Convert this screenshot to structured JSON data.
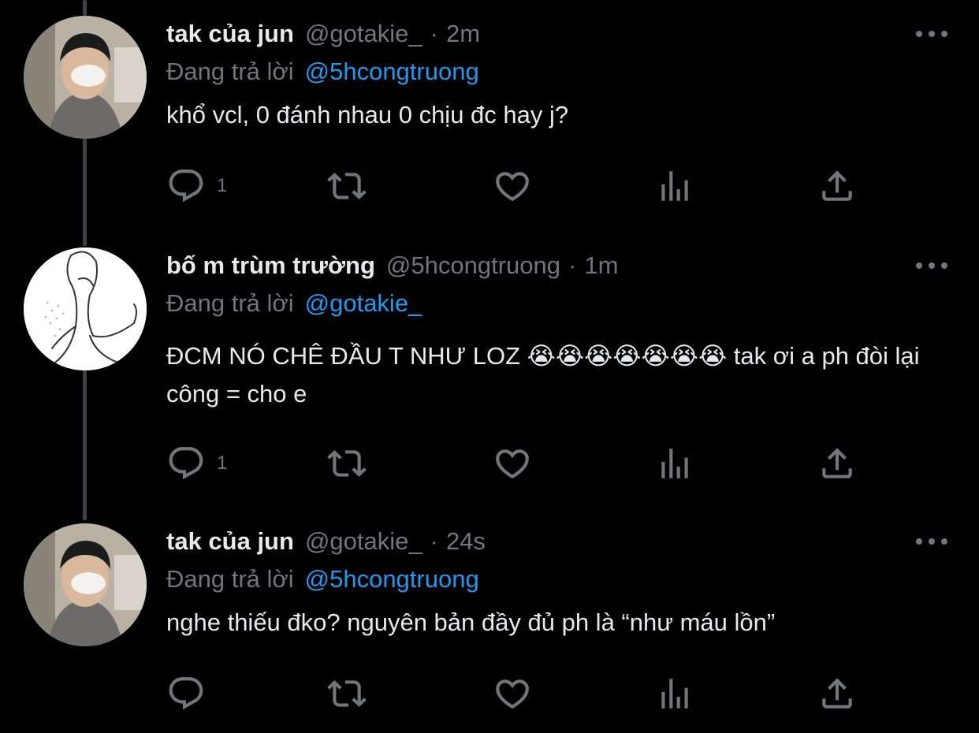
{
  "tweets": [
    {
      "display_name": "tak của jun",
      "handle": "@gotakie_",
      "separator": "·",
      "time": "2m",
      "replying_label": "Đang trả lời",
      "replying_to": "@5hcongtruong",
      "text": "khổ vcl, 0 đánh nhau 0 chịu đc hay j?",
      "reply_count": "1",
      "retweet_count": "",
      "like_count": ""
    },
    {
      "display_name": "bố m trùm trường",
      "handle": "@5hcongtruong",
      "separator": "·",
      "time": "1m",
      "replying_label": "Đang trả lời",
      "replying_to": "@gotakie_",
      "text": "ĐCM NÓ CHÊ ĐẦU T NHƯ LOZ 😭😭😭😭😭😭😭  tak ơi a ph đòi lại công = cho e",
      "reply_count": "1",
      "retweet_count": "",
      "like_count": ""
    },
    {
      "display_name": "tak của jun",
      "handle": "@gotakie_",
      "separator": "·",
      "time": "24s",
      "replying_label": "Đang trả lời",
      "replying_to": "@5hcongtruong",
      "text": "nghe thiếu đko? nguyên bản đầy đủ ph là “như máu lồn”",
      "reply_count": "",
      "retweet_count": "",
      "like_count": ""
    }
  ],
  "icons": {
    "reply": "reply-icon",
    "retweet": "retweet-icon",
    "like": "heart-icon",
    "analytics": "analytics-icon",
    "share": "share-icon",
    "more": "more-icon"
  },
  "colors": {
    "background": "#000000",
    "text": "#e7e9ea",
    "secondary": "#71767b",
    "mention": "#1d9bf0",
    "thread_line": "#3e4144"
  }
}
